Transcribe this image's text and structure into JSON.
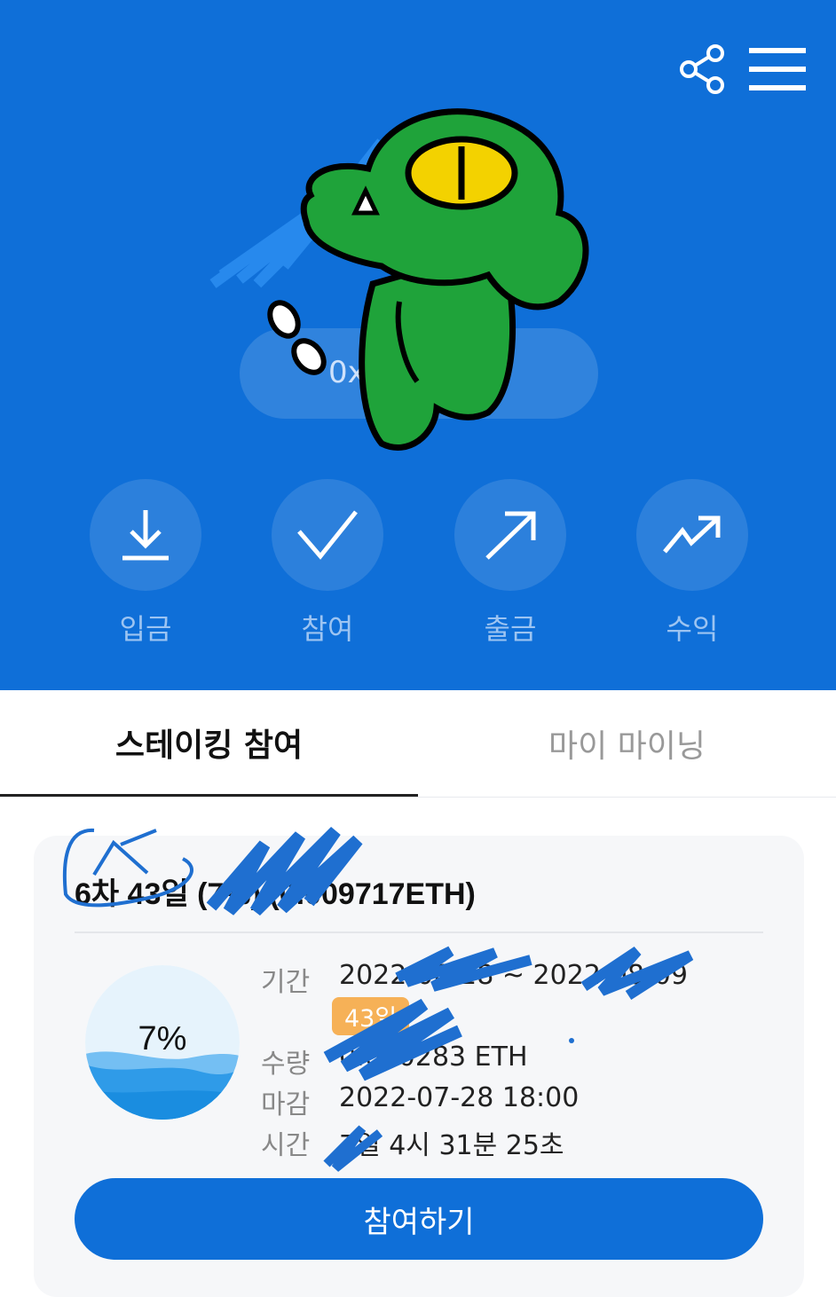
{
  "header": {
    "share_icon": "share-icon",
    "menu_icon": "hamburger-menu-icon",
    "address_partial": "0x"
  },
  "actions": [
    {
      "label": "입금",
      "icon": "download-icon"
    },
    {
      "label": "참여",
      "icon": "check-icon"
    },
    {
      "label": "출금",
      "icon": "arrow-up-right-icon"
    },
    {
      "label": "수익",
      "icon": "trending-up-icon"
    }
  ],
  "tabs": [
    {
      "label": "스테이킹 참여",
      "active": true
    },
    {
      "label": "마이 마이닝",
      "active": false
    }
  ],
  "card": {
    "title": "6차 43일 (7%) (0.009717ETH)",
    "progress_percent": 7,
    "progress_text": "7%",
    "rows": [
      {
        "key": "기간",
        "value": "2022-06-28 ~ 2022-08-09"
      },
      {
        "key": "수량",
        "value": "0.000283 ETH"
      },
      {
        "key": "마감",
        "value": "2022-07-28 18:00"
      },
      {
        "key": "시간",
        "value": "7일 4시 31분 25초"
      }
    ],
    "duration_badge": "43일",
    "cta_label": "참여하기"
  },
  "colors": {
    "primary": "#0f6fd8",
    "badge": "#f6b157",
    "mascot_green": "#1fa33a",
    "mascot_eye": "#f3d200"
  }
}
